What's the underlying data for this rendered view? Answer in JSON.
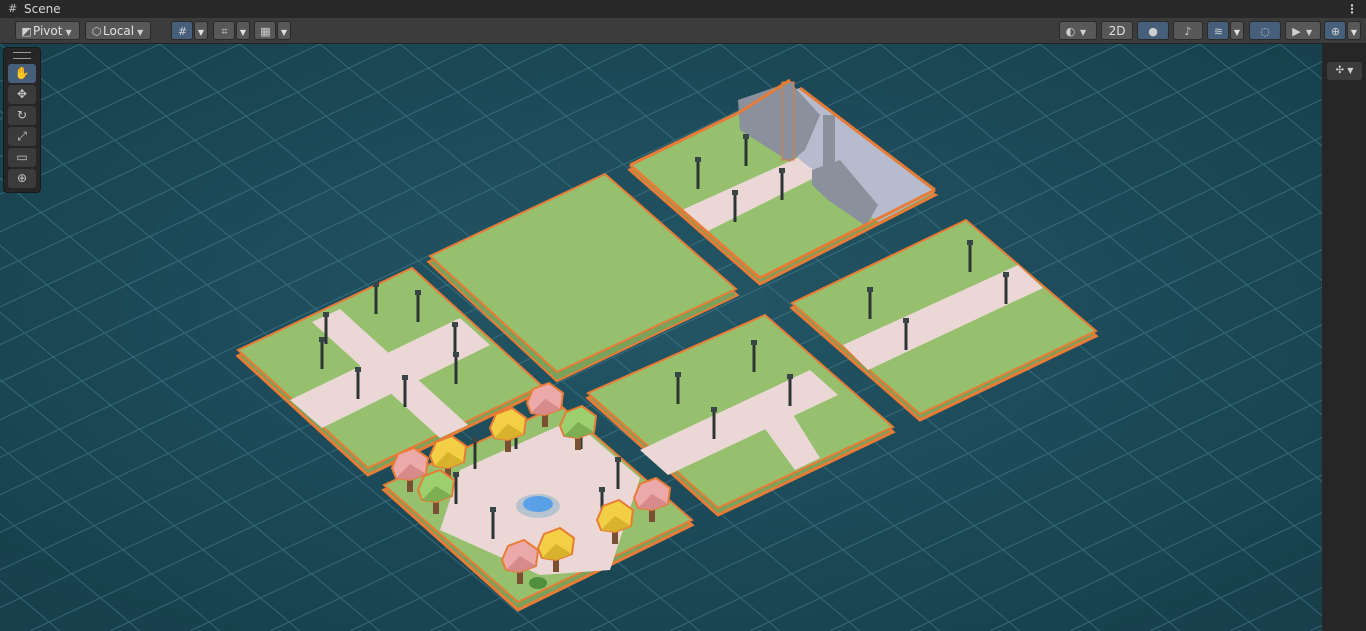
{
  "window": {
    "tab_title": "Scene",
    "tab_icon": "grid-icon",
    "menu_icon": "kebab-menu-icon"
  },
  "toolbar": {
    "pivot_label": "Pivot",
    "local_label": "Local",
    "two_d_label": "2D",
    "pivot_icon": "pivot-icon",
    "local_icon": "cube-icon"
  },
  "tools": [
    {
      "name": "view-tool",
      "icon": "hand-icon",
      "glyph": "✋",
      "active": true
    },
    {
      "name": "move-tool",
      "icon": "move-icon",
      "glyph": "✥",
      "active": false
    },
    {
      "name": "rotate-tool",
      "icon": "rotate-icon",
      "glyph": "↻",
      "active": false
    },
    {
      "name": "scale-tool",
      "icon": "scale-icon",
      "glyph": "⤢",
      "active": false
    },
    {
      "name": "rect-tool",
      "icon": "rect-icon",
      "glyph": "▭",
      "active": false
    },
    {
      "name": "transform-tool",
      "icon": "transform-icon",
      "glyph": "⊕",
      "active": false
    }
  ],
  "colors": {
    "background": "#1d4a58",
    "grid": "#4c8595",
    "grass": "#96c06e",
    "path": "#ecd7d7",
    "selection_outline": "#e87b35",
    "building": "#9097a3",
    "roof": "#b6bccd"
  }
}
